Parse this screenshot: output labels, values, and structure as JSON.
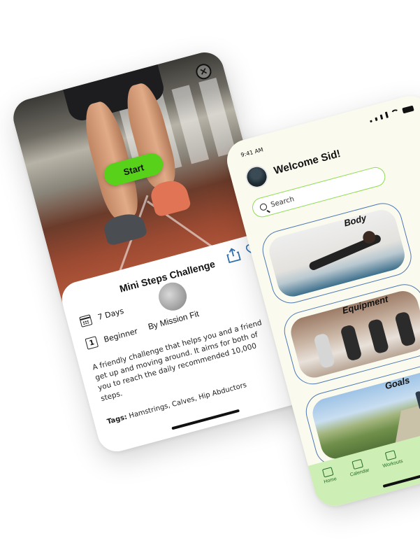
{
  "challenge": {
    "close_glyph": "×",
    "start_label": "Start",
    "title": "Mini Steps Challenge",
    "duration": "7 Days",
    "level_number": "1",
    "level": "Beginner",
    "author": "By Mission Fit",
    "description": "A friendly challenge that helps you and a friend get up and moving around. It aims for both of you to reach the daily recommended 10,000 steps.",
    "tags_label": "Tags:",
    "tags": "Hamstrings, Calves, Hip Abductors"
  },
  "home": {
    "status_time": "9:41 AM",
    "welcome": "Welcome Sid!",
    "search_placeholder": "Search",
    "categories": [
      {
        "label": "Body"
      },
      {
        "label": "Equipment"
      },
      {
        "label": "Goals"
      }
    ],
    "tabs": [
      {
        "label": "Home",
        "icon": "home-icon"
      },
      {
        "label": "Calendar",
        "icon": "calendar-icon"
      },
      {
        "label": "Workouts",
        "icon": "dumbbell-icon"
      }
    ]
  },
  "colors": {
    "accent_green": "#58d11b",
    "search_border": "#8fdc52",
    "card_border": "#4c78b5",
    "tabbar_bg": "#cdeeb4",
    "phone2_bg": "#fbfaee"
  }
}
